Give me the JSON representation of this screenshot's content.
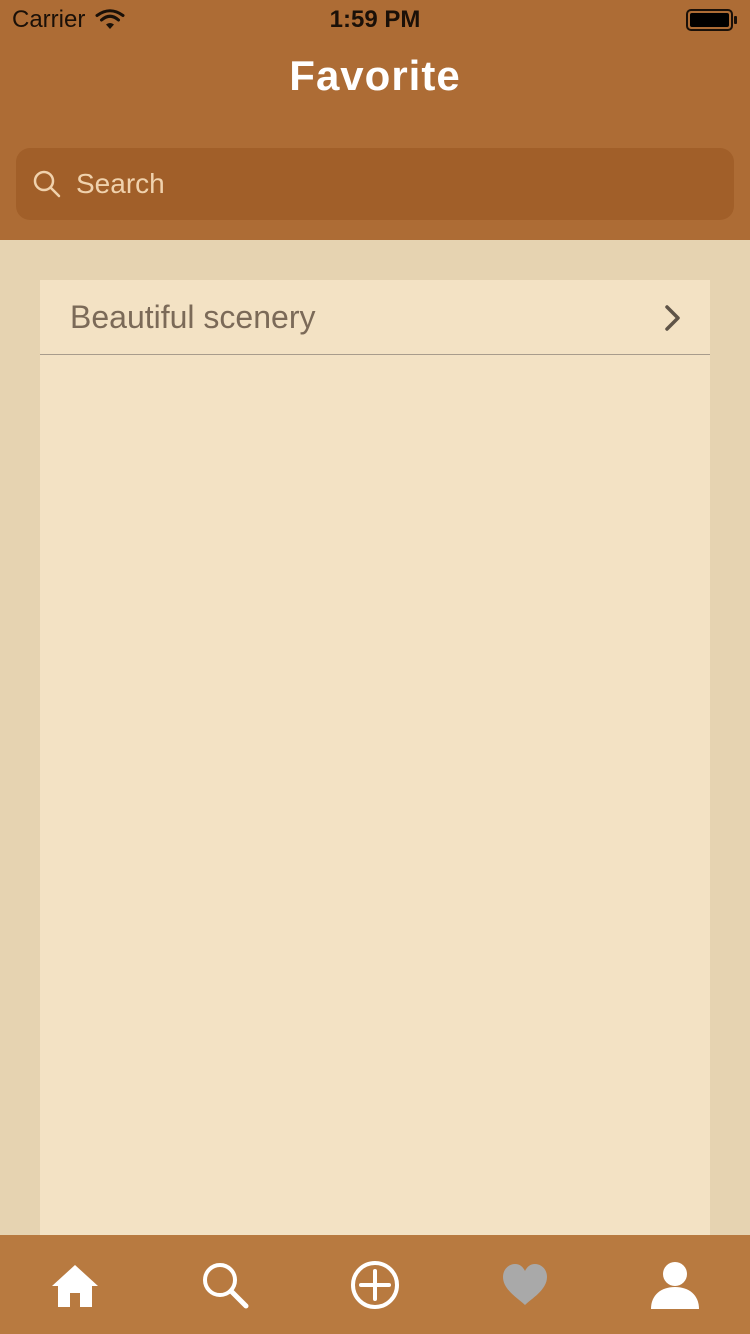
{
  "status_bar": {
    "carrier": "Carrier",
    "time": "1:59 PM"
  },
  "header": {
    "title": "Favorite"
  },
  "search": {
    "placeholder": "Search"
  },
  "list": {
    "items": [
      {
        "label": "Beautiful scenery"
      }
    ]
  },
  "tab_bar": {
    "tabs": [
      {
        "icon": "home-icon",
        "active": false
      },
      {
        "icon": "search-icon",
        "active": false
      },
      {
        "icon": "add-circle-icon",
        "active": false
      },
      {
        "icon": "heart-icon",
        "active": true
      },
      {
        "icon": "profile-icon",
        "active": false
      }
    ]
  },
  "colors": {
    "header_bg": "#ad6c35",
    "search_bg": "#a15f29",
    "page_bg": "#e6d3b1",
    "panel_bg": "#f3e2c4",
    "tab_bar_bg": "#b87a40",
    "tab_icon": "#ffffff",
    "tab_icon_active": "#a9a9a9"
  }
}
